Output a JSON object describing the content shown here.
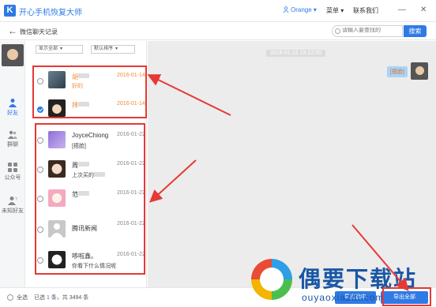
{
  "app": {
    "logo_letter": "K",
    "title": "开心手机恢复大师"
  },
  "header": {
    "user": "Orange",
    "menu": "菜单",
    "contact": "联系我们",
    "minimize": "—",
    "close": "✕"
  },
  "subheader": {
    "title": "微信聊天记录",
    "search_placeholder": "请输入要查找的",
    "search_button": "搜索"
  },
  "nav": [
    {
      "label": "好友",
      "icon": "person-icon",
      "active": true
    },
    {
      "label": "群聊",
      "icon": "group-icon",
      "active": false
    },
    {
      "label": "公众号",
      "icon": "grid-icon",
      "active": false
    },
    {
      "label": "未知好友",
      "icon": "unknown-user-icon",
      "active": false
    }
  ],
  "filters": {
    "show": "显示全部",
    "sort": "默认排序"
  },
  "contacts": [
    {
      "name": "胡",
      "date": "2016-01-14",
      "msg": "好的",
      "highlight": true,
      "checked": false
    },
    {
      "name": "拜",
      "date": "2016-01-14",
      "msg": "",
      "highlight": true,
      "checked": true
    },
    {
      "name": "JoyceChiong",
      "date": "2016-01-22",
      "msg": "[捂脸]",
      "highlight": false,
      "checked": false
    },
    {
      "name": "周",
      "date": "2016-01-22",
      "msg": "上次买的",
      "highlight": false,
      "checked": false
    },
    {
      "name": "范",
      "date": "2016-01-22",
      "msg": "",
      "highlight": false,
      "checked": false
    },
    {
      "name": "腾讯新闻",
      "date": "2016-01-22",
      "msg": "",
      "highlight": false,
      "checked": false
    },
    {
      "name": "哆啦鑫。",
      "date": "2016-01-22",
      "msg": "你看下什么情况呢",
      "highlight": false,
      "checked": false
    }
  ],
  "chat": {
    "timestamp": "2016-01-21 15:12:00",
    "bubble": "[捂脸]"
  },
  "bottom": {
    "select_all": "全选",
    "selected_prefix": "已选",
    "selected_count": "1",
    "total_text": "条，共 3494 条",
    "export_selected": "导出选中",
    "export_all": "导出全部"
  },
  "watermark": {
    "text": "偶要下载站",
    "url": "ouyaoxiazai.com"
  },
  "colors": {
    "accent": "#2f7ae5",
    "highlight": "#f08a3c",
    "annotation": "#e53935"
  }
}
